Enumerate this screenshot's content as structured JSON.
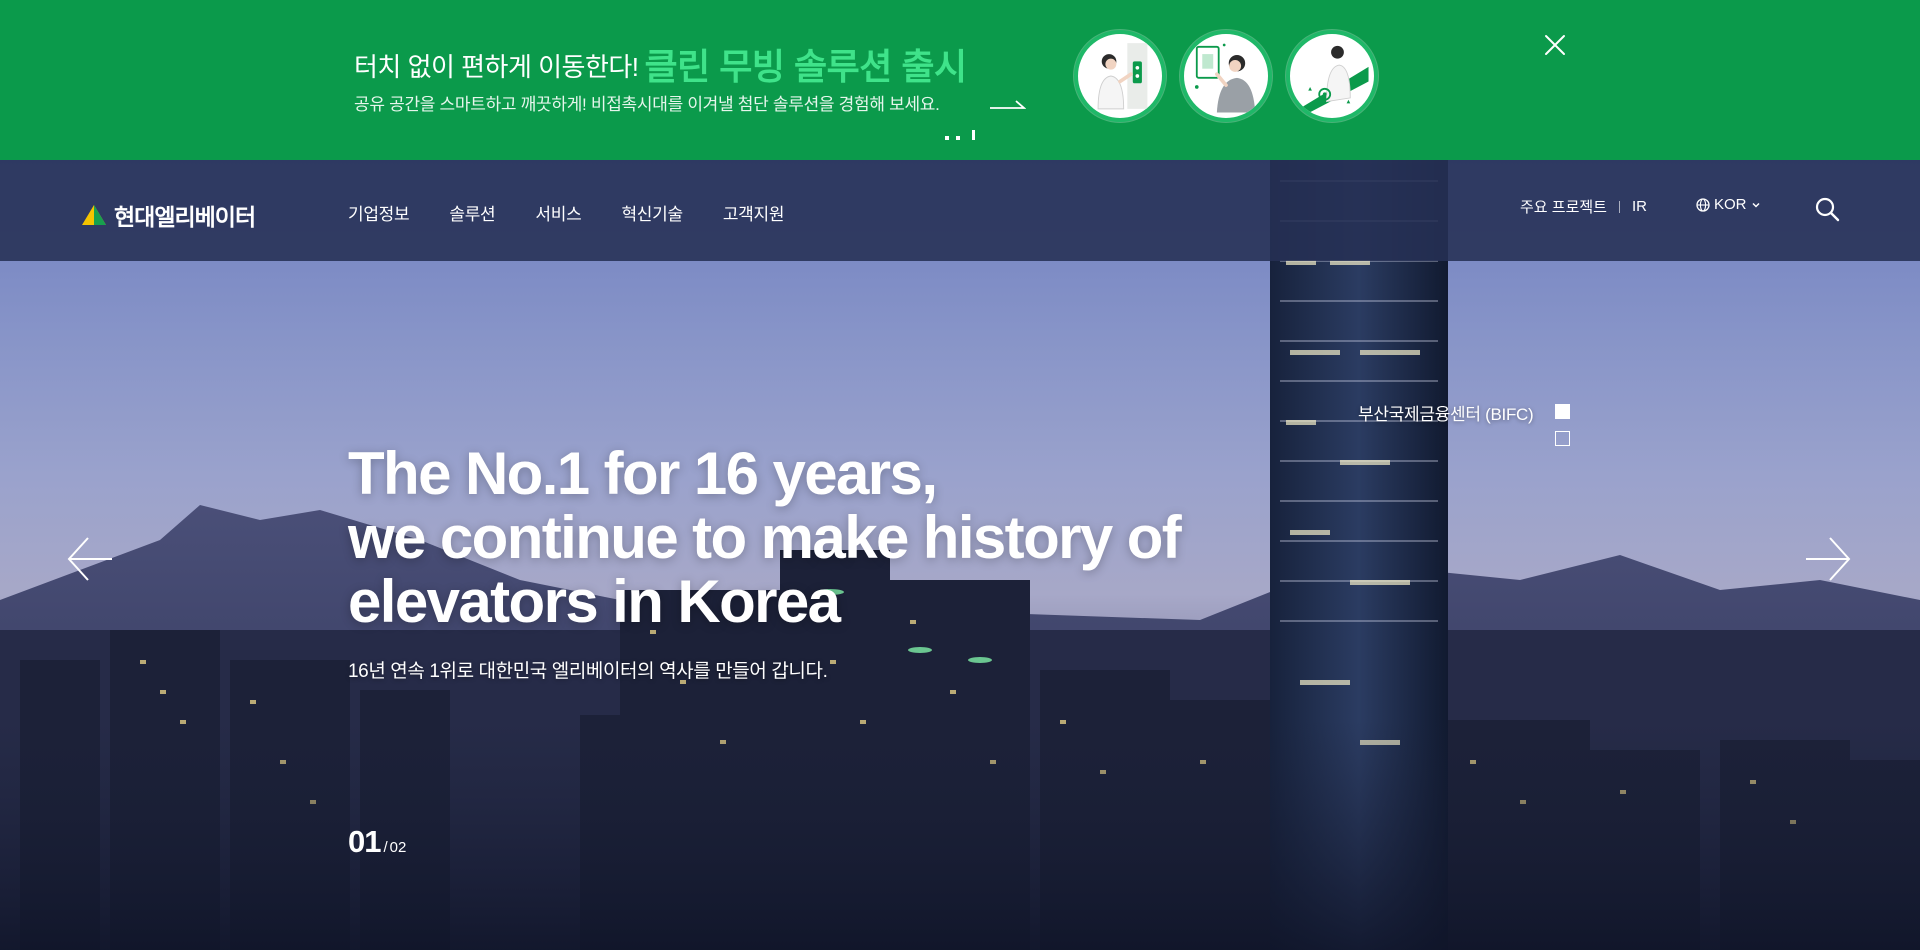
{
  "promo": {
    "title_lead": "터치 없이 편하게 이동한다!",
    "title_highlight": "클린 무빙 솔루션 출시",
    "subtitle": "공유 공간을 스마트하고 깨끗하게! 비접촉시대를 이겨낼 첨단 솔루션을 경험해 보세요.",
    "illustrations": [
      "person-elevator-button-icon",
      "person-touchless-panel-icon",
      "person-qr-elevator-icon"
    ],
    "accent_color": "#0b9a4b",
    "highlight_color": "#3fe38a"
  },
  "header": {
    "logo_text": "현대엘리베이터",
    "nav": [
      "기업정보",
      "솔루션",
      "서비스",
      "혁신기술",
      "고객지원"
    ],
    "util_links": [
      "주요 프로젝트",
      "IR"
    ],
    "language": "KOR"
  },
  "hero": {
    "title_line1": "The No.1 for 16 years,",
    "title_line2": "we continue to make history of",
    "title_line3": "elevators in Korea",
    "subtitle": "16년 연속 1위로 대한민국 엘리베이터의 역사를 만들어 갑니다.",
    "slide_current": "01",
    "slide_separator": "/",
    "slide_total": "02",
    "location_label": "부산국제금융센터 (BIFC)"
  }
}
